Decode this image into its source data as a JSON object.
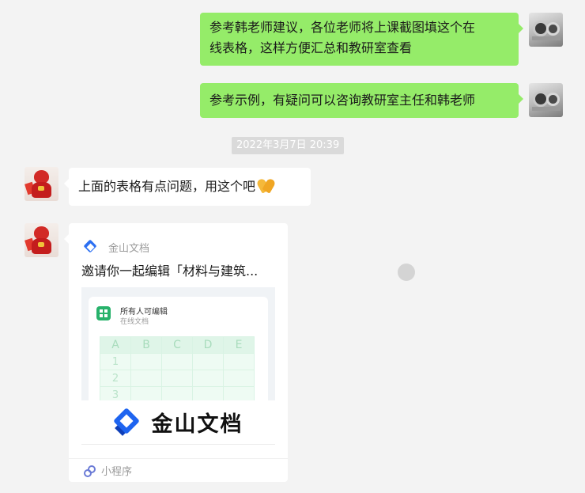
{
  "messages": {
    "m1": {
      "line1": "参考韩老师建议，各位老师将上课截图填这个在",
      "line2": "线表格，这样方便汇总和教研室查看"
    },
    "m2": {
      "text": "参考示例，有疑问可以咨询教研室主任和韩老师"
    },
    "timestamp": "2022年3月7日 20:39",
    "m3": {
      "text": "上面的表格有点问题，用这个吧"
    },
    "card": {
      "source": "金山文档",
      "title": "邀请你一起编辑「材料与建筑...",
      "preview": {
        "permission": "所有人可编辑",
        "doc_type": "在线文档",
        "columns": [
          "A",
          "B",
          "C",
          "D",
          "E"
        ],
        "rows": [
          "1",
          "2",
          "3"
        ]
      },
      "brand": "金山文档",
      "footer": "小程序"
    }
  },
  "colors": {
    "sent_bubble": "#95ec69",
    "received_bubble": "#ffffff",
    "background": "#f3f3f3",
    "kingsoft_blue": "#1e64f0"
  },
  "icons": {
    "sender_avatar": "camera-lens-avatar",
    "receiver_avatar": "red-mascot-avatar",
    "card_source": "kingsoft-docs-icon",
    "emoji": "folded-hands-emoji",
    "footer": "mini-program-icon"
  }
}
